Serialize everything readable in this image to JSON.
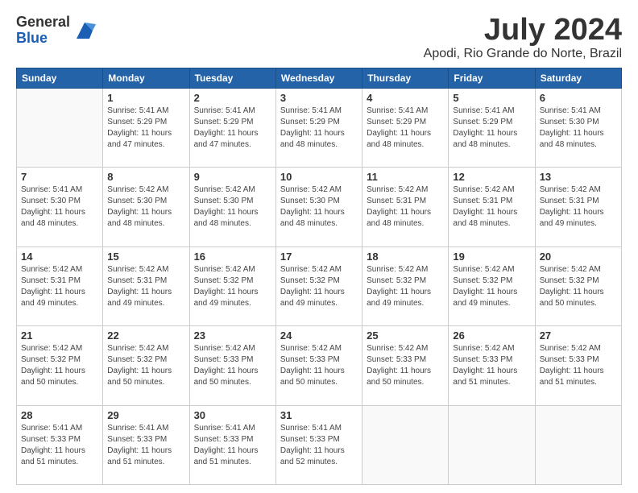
{
  "logo": {
    "general": "General",
    "blue": "Blue"
  },
  "title": {
    "month_year": "July 2024",
    "location": "Apodi, Rio Grande do Norte, Brazil"
  },
  "days_header": [
    "Sunday",
    "Monday",
    "Tuesday",
    "Wednesday",
    "Thursday",
    "Friday",
    "Saturday"
  ],
  "weeks": [
    [
      {
        "day": "",
        "info": ""
      },
      {
        "day": "1",
        "info": "Sunrise: 5:41 AM\nSunset: 5:29 PM\nDaylight: 11 hours\nand 47 minutes."
      },
      {
        "day": "2",
        "info": "Sunrise: 5:41 AM\nSunset: 5:29 PM\nDaylight: 11 hours\nand 47 minutes."
      },
      {
        "day": "3",
        "info": "Sunrise: 5:41 AM\nSunset: 5:29 PM\nDaylight: 11 hours\nand 48 minutes."
      },
      {
        "day": "4",
        "info": "Sunrise: 5:41 AM\nSunset: 5:29 PM\nDaylight: 11 hours\nand 48 minutes."
      },
      {
        "day": "5",
        "info": "Sunrise: 5:41 AM\nSunset: 5:29 PM\nDaylight: 11 hours\nand 48 minutes."
      },
      {
        "day": "6",
        "info": "Sunrise: 5:41 AM\nSunset: 5:30 PM\nDaylight: 11 hours\nand 48 minutes."
      }
    ],
    [
      {
        "day": "7",
        "info": "Sunrise: 5:41 AM\nSunset: 5:30 PM\nDaylight: 11 hours\nand 48 minutes."
      },
      {
        "day": "8",
        "info": "Sunrise: 5:42 AM\nSunset: 5:30 PM\nDaylight: 11 hours\nand 48 minutes."
      },
      {
        "day": "9",
        "info": "Sunrise: 5:42 AM\nSunset: 5:30 PM\nDaylight: 11 hours\nand 48 minutes."
      },
      {
        "day": "10",
        "info": "Sunrise: 5:42 AM\nSunset: 5:30 PM\nDaylight: 11 hours\nand 48 minutes."
      },
      {
        "day": "11",
        "info": "Sunrise: 5:42 AM\nSunset: 5:31 PM\nDaylight: 11 hours\nand 48 minutes."
      },
      {
        "day": "12",
        "info": "Sunrise: 5:42 AM\nSunset: 5:31 PM\nDaylight: 11 hours\nand 48 minutes."
      },
      {
        "day": "13",
        "info": "Sunrise: 5:42 AM\nSunset: 5:31 PM\nDaylight: 11 hours\nand 49 minutes."
      }
    ],
    [
      {
        "day": "14",
        "info": "Sunrise: 5:42 AM\nSunset: 5:31 PM\nDaylight: 11 hours\nand 49 minutes."
      },
      {
        "day": "15",
        "info": "Sunrise: 5:42 AM\nSunset: 5:31 PM\nDaylight: 11 hours\nand 49 minutes."
      },
      {
        "day": "16",
        "info": "Sunrise: 5:42 AM\nSunset: 5:32 PM\nDaylight: 11 hours\nand 49 minutes."
      },
      {
        "day": "17",
        "info": "Sunrise: 5:42 AM\nSunset: 5:32 PM\nDaylight: 11 hours\nand 49 minutes."
      },
      {
        "day": "18",
        "info": "Sunrise: 5:42 AM\nSunset: 5:32 PM\nDaylight: 11 hours\nand 49 minutes."
      },
      {
        "day": "19",
        "info": "Sunrise: 5:42 AM\nSunset: 5:32 PM\nDaylight: 11 hours\nand 49 minutes."
      },
      {
        "day": "20",
        "info": "Sunrise: 5:42 AM\nSunset: 5:32 PM\nDaylight: 11 hours\nand 50 minutes."
      }
    ],
    [
      {
        "day": "21",
        "info": "Sunrise: 5:42 AM\nSunset: 5:32 PM\nDaylight: 11 hours\nand 50 minutes."
      },
      {
        "day": "22",
        "info": "Sunrise: 5:42 AM\nSunset: 5:32 PM\nDaylight: 11 hours\nand 50 minutes."
      },
      {
        "day": "23",
        "info": "Sunrise: 5:42 AM\nSunset: 5:33 PM\nDaylight: 11 hours\nand 50 minutes."
      },
      {
        "day": "24",
        "info": "Sunrise: 5:42 AM\nSunset: 5:33 PM\nDaylight: 11 hours\nand 50 minutes."
      },
      {
        "day": "25",
        "info": "Sunrise: 5:42 AM\nSunset: 5:33 PM\nDaylight: 11 hours\nand 50 minutes."
      },
      {
        "day": "26",
        "info": "Sunrise: 5:42 AM\nSunset: 5:33 PM\nDaylight: 11 hours\nand 51 minutes."
      },
      {
        "day": "27",
        "info": "Sunrise: 5:42 AM\nSunset: 5:33 PM\nDaylight: 11 hours\nand 51 minutes."
      }
    ],
    [
      {
        "day": "28",
        "info": "Sunrise: 5:41 AM\nSunset: 5:33 PM\nDaylight: 11 hours\nand 51 minutes."
      },
      {
        "day": "29",
        "info": "Sunrise: 5:41 AM\nSunset: 5:33 PM\nDaylight: 11 hours\nand 51 minutes."
      },
      {
        "day": "30",
        "info": "Sunrise: 5:41 AM\nSunset: 5:33 PM\nDaylight: 11 hours\nand 51 minutes."
      },
      {
        "day": "31",
        "info": "Sunrise: 5:41 AM\nSunset: 5:33 PM\nDaylight: 11 hours\nand 52 minutes."
      },
      {
        "day": "",
        "info": ""
      },
      {
        "day": "",
        "info": ""
      },
      {
        "day": "",
        "info": ""
      }
    ]
  ]
}
